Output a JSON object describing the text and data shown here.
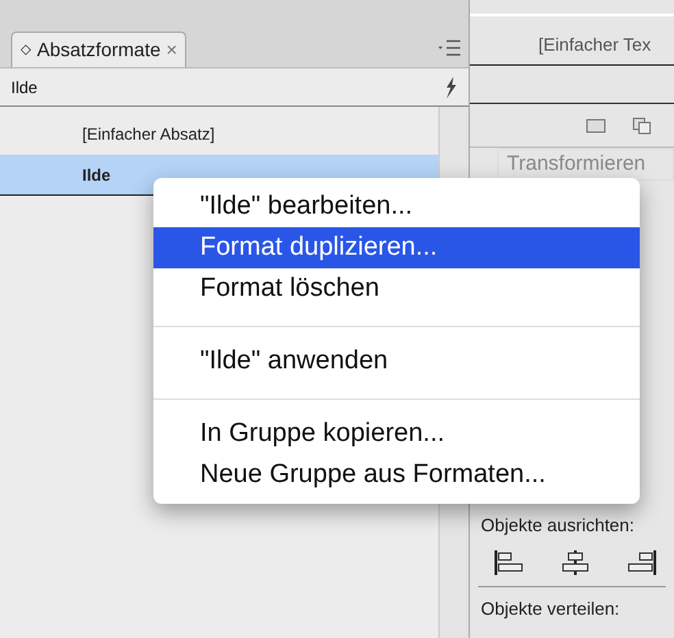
{
  "panel": {
    "tab": {
      "icon": "◇",
      "label": "Absatzformate",
      "selected": true
    },
    "close": "×",
    "current_style": "Ilde",
    "styles": [
      {
        "label": "[Einfacher Absatz]",
        "selected": false
      },
      {
        "label": "Ilde",
        "selected": true
      }
    ]
  },
  "context_menu": {
    "groups": [
      [
        {
          "label": "\"Ilde\" bearbeiten...",
          "selected": false
        },
        {
          "label": "Format duplizieren...",
          "selected": true
        },
        {
          "label": "Format löschen",
          "selected": false
        }
      ],
      [
        {
          "label": "\"Ilde\" anwenden",
          "selected": false
        }
      ],
      [
        {
          "label": "In Gruppe kopieren...",
          "selected": false
        },
        {
          "label": "Neue Gruppe aus Formaten...",
          "selected": false
        }
      ]
    ]
  },
  "side_panel": {
    "styles": [
      "[Einfacher Tex"
    ],
    "transform_tab": "Transformieren",
    "align_label": "Objekte ausrichten:",
    "distribute_label": "Objekte verteilen:"
  }
}
